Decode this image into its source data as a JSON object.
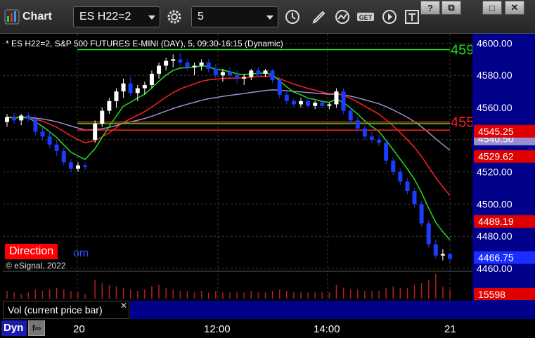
{
  "toolbar": {
    "app_label": "Chart",
    "symbol": "ES H22=2",
    "interval": "5",
    "window_buttons": [
      "?",
      "⧉",
      "□",
      "✕"
    ]
  },
  "chart": {
    "info_line": "* ES H22=2, S&P 500 FUTURES E-MINI (DAY), 5, 09:30-16:15 (Dynamic)",
    "direction_label": "Direction",
    "com_fragment": "om",
    "copyright": "© eSignal, 2022",
    "price_ticks": [
      "4600.00",
      "4580.00",
      "4560.00",
      "4540.00",
      "4520.00",
      "4500.00",
      "4480.00",
      "4460.00"
    ],
    "level_labels": {
      "green": "459",
      "red": "455"
    },
    "badges": {
      "red_upper": "4545.25",
      "lavender": "4540.50",
      "red_lower": "4529.62",
      "red_bottom": "4489.19",
      "last_price": "4466.75",
      "volume": "15598"
    },
    "time_ticks": [
      "20",
      "12:00",
      "14:00",
      "21"
    ],
    "colors": {
      "up": "#ffffff",
      "down": "#1a3cff",
      "ema_green": "#22dd22",
      "ema_red": "#ff2020",
      "ma_lavender": "#9b8fd0"
    }
  },
  "volume_panel": {
    "label": "Vol (current price bar)",
    "close": "✕"
  },
  "status": {
    "dyn_label": "Dyn",
    "button_label": "f∞"
  },
  "chart_data": {
    "type": "candlestick",
    "symbol": "ES H22=2",
    "interval": "5",
    "y_range": [
      4460,
      4605
    ],
    "last_price": 4466.75,
    "last_volume": 15598,
    "candles": [
      [
        4551,
        4556,
        4548,
        4554
      ],
      [
        4554,
        4557,
        4550,
        4552
      ],
      [
        4552,
        4556,
        4549,
        4555
      ],
      [
        4555,
        4557,
        4551,
        4553
      ],
      [
        4553,
        4555,
        4543,
        4545
      ],
      [
        4545,
        4548,
        4540,
        4542
      ],
      [
        4542,
        4545,
        4535,
        4537
      ],
      [
        4537,
        4540,
        4530,
        4533
      ],
      [
        4533,
        4535,
        4524,
        4526
      ],
      [
        4526,
        4528,
        4520,
        4522
      ],
      [
        4522,
        4526,
        4520,
        4524
      ],
      [
        4524,
        4526,
        4521,
        4523
      ],
      [
        4540,
        4552,
        4538,
        4550
      ],
      [
        4550,
        4560,
        4548,
        4558
      ],
      [
        4558,
        4566,
        4556,
        4564
      ],
      [
        4564,
        4572,
        4560,
        4570
      ],
      [
        4570,
        4578,
        4566,
        4575
      ],
      [
        4575,
        4579,
        4567,
        4569
      ],
      [
        4569,
        4574,
        4564,
        4572
      ],
      [
        4572,
        4576,
        4568,
        4574
      ],
      [
        4574,
        4583,
        4572,
        4581
      ],
      [
        4581,
        4588,
        4578,
        4586
      ],
      [
        4586,
        4591,
        4583,
        4589
      ],
      [
        4589,
        4593,
        4585,
        4590
      ],
      [
        4590,
        4594,
        4586,
        4588
      ],
      [
        4588,
        4590,
        4583,
        4585
      ],
      [
        4585,
        4588,
        4580,
        4586
      ],
      [
        4586,
        4590,
        4583,
        4588
      ],
      [
        4588,
        4590,
        4582,
        4584
      ],
      [
        4584,
        4587,
        4578,
        4580
      ],
      [
        4580,
        4584,
        4576,
        4582
      ],
      [
        4582,
        4585,
        4578,
        4580
      ],
      [
        4580,
        4583,
        4575,
        4578
      ],
      [
        4578,
        4581,
        4574,
        4579
      ],
      [
        4579,
        4584,
        4577,
        4583
      ],
      [
        4583,
        4585,
        4579,
        4581
      ],
      [
        4581,
        4584,
        4579,
        4583
      ],
      [
        4583,
        4584,
        4575,
        4577
      ],
      [
        4577,
        4579,
        4566,
        4568
      ],
      [
        4568,
        4570,
        4562,
        4564
      ],
      [
        4564,
        4566,
        4560,
        4562
      ],
      [
        4562,
        4566,
        4560,
        4564
      ],
      [
        4564,
        4566,
        4560,
        4561
      ],
      [
        4561,
        4564,
        4559,
        4563
      ],
      [
        4563,
        4565,
        4560,
        4561
      ],
      [
        4561,
        4563,
        4559,
        4562
      ],
      [
        4562,
        4572,
        4560,
        4570
      ],
      [
        4570,
        4572,
        4556,
        4558
      ],
      [
        4558,
        4560,
        4550,
        4552
      ],
      [
        4552,
        4554,
        4545,
        4547
      ],
      [
        4547,
        4549,
        4540,
        4542
      ],
      [
        4542,
        4545,
        4538,
        4540
      ],
      [
        4540,
        4543,
        4536,
        4538
      ],
      [
        4538,
        4540,
        4525,
        4527
      ],
      [
        4527,
        4529,
        4518,
        4520
      ],
      [
        4520,
        4522,
        4512,
        4514
      ],
      [
        4514,
        4516,
        4506,
        4508
      ],
      [
        4508,
        4510,
        4498,
        4500
      ],
      [
        4500,
        4502,
        4486,
        4488
      ],
      [
        4488,
        4490,
        4473,
        4475
      ],
      [
        4475,
        4478,
        4466,
        4468
      ],
      [
        4468,
        4472,
        4465,
        4469
      ],
      [
        4469,
        4470,
        4464,
        4466
      ]
    ],
    "volumes": [
      5,
      4,
      3,
      4,
      6,
      5,
      6,
      7,
      6,
      5,
      4,
      3,
      12,
      10,
      9,
      8,
      7,
      6,
      5,
      6,
      8,
      9,
      7,
      6,
      5,
      5,
      4,
      5,
      4,
      5,
      4,
      4,
      4,
      4,
      5,
      4,
      4,
      5,
      6,
      5,
      4,
      4,
      4,
      4,
      4,
      4,
      9,
      7,
      6,
      6,
      5,
      5,
      5,
      7,
      8,
      7,
      7,
      9,
      10,
      12,
      16,
      8,
      6
    ],
    "levels": {
      "green_upper": 4596,
      "green_lower": 4550,
      "red_upper": 4551,
      "red_lower": 4546
    }
  }
}
